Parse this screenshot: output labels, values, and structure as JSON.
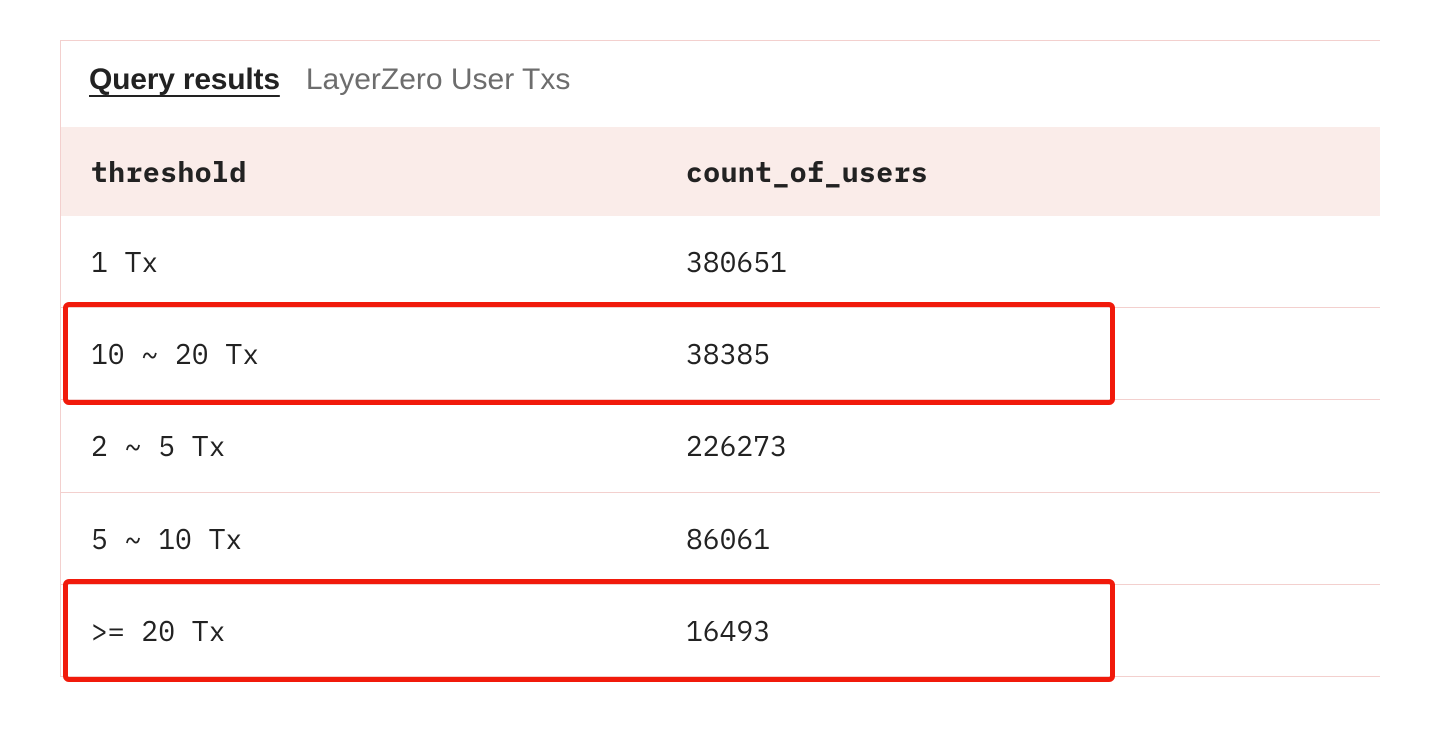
{
  "header": {
    "title": "Query results",
    "subtitle": "LayerZero User Txs"
  },
  "table": {
    "columns": [
      "threshold",
      "count_of_users"
    ],
    "rows": [
      {
        "threshold": "1 Tx",
        "count": "380651",
        "highlighted": false
      },
      {
        "threshold": "10 ~ 20 Tx",
        "count": "38385",
        "highlighted": true
      },
      {
        "threshold": "2 ~ 5 Tx",
        "count": "226273",
        "highlighted": false
      },
      {
        "threshold": "5 ~ 10 Tx",
        "count": "86061",
        "highlighted": false
      },
      {
        "threshold": ">= 20 Tx",
        "count": "16493",
        "highlighted": true
      }
    ]
  },
  "chart_data": {
    "type": "table",
    "title": "LayerZero User Txs",
    "columns": [
      "threshold",
      "count_of_users"
    ],
    "rows": [
      [
        "1 Tx",
        380651
      ],
      [
        "10 ~ 20 Tx",
        38385
      ],
      [
        "2 ~ 5 Tx",
        226273
      ],
      [
        "5 ~ 10 Tx",
        86061
      ],
      [
        ">= 20 Tx",
        16493
      ]
    ]
  }
}
